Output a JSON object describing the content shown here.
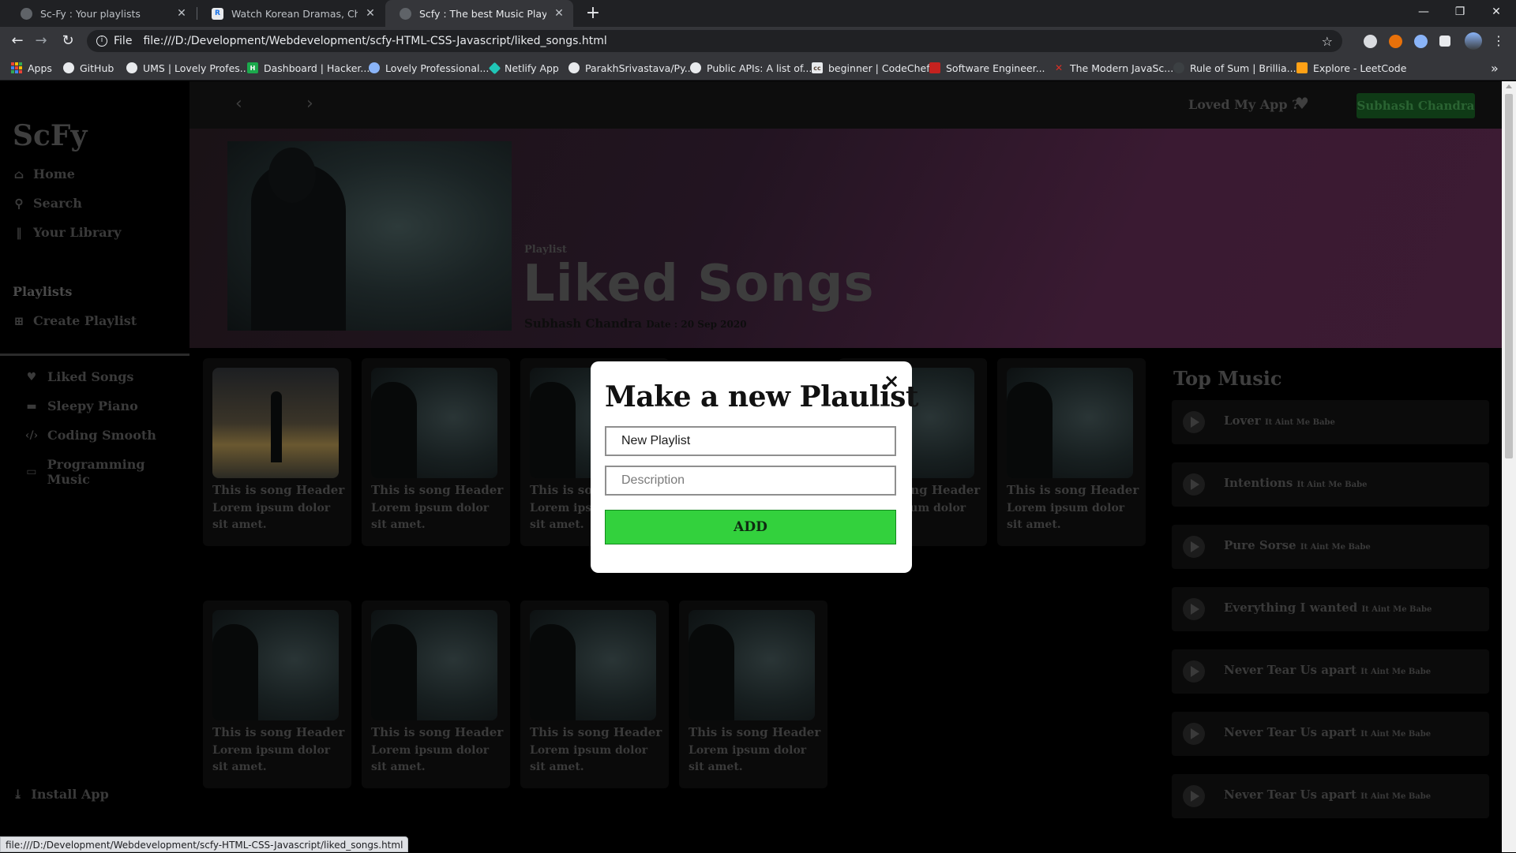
{
  "browser": {
    "tabs": [
      {
        "title": "Sc-Fy : Your playlists"
      },
      {
        "title": "Watch Korean Dramas, Chinese D"
      },
      {
        "title": "Scfy : The best Music Player"
      }
    ],
    "new_tab": "+",
    "window_controls": {
      "minimize": "—",
      "restore": "❐",
      "close": "✕"
    },
    "omnibox": {
      "protocol": "File",
      "url": "file:///D:/Development/Webdevelopment/scfy-HTML-CSS-Javascript/liked_songs.html"
    },
    "bookmarks": [
      "Apps",
      "GitHub",
      "UMS | Lovely Profes...",
      "Dashboard | Hacker...",
      "Lovely Professional...",
      "Netlify App",
      "ParakhSrivastava/Py...",
      "Public APIs: A list of...",
      "beginner | CodeChef",
      "Software Engineer...",
      "The Modern JavaSc...",
      "Rule of Sum | Brillia...",
      "Explore - LeetCode"
    ],
    "bookmarks_more": "»",
    "status_url": "file:///D:/Development/Webdevelopment/scfy-HTML-CSS-Javascript/liked_songs.html"
  },
  "sidebar": {
    "logo": "ScFy",
    "nav": [
      {
        "label": "Home",
        "icon": "home-icon"
      },
      {
        "label": "Search",
        "icon": "search-icon"
      },
      {
        "label": "Your Library",
        "icon": "library-icon"
      }
    ],
    "playlists_heading": "Playlists",
    "create_playlist": "Create Playlist",
    "playlists": [
      {
        "label": "Liked Songs",
        "icon": "heart-icon"
      },
      {
        "label": "Sleepy Piano",
        "icon": "bed-icon"
      },
      {
        "label": "Coding Smooth",
        "icon": "code-icon"
      },
      {
        "label": "Programming Music",
        "icon": "laptop-icon"
      }
    ],
    "install": "Install App"
  },
  "topnav": {
    "loved": "Loved My App ?",
    "user": "Subhash Chandra"
  },
  "banner": {
    "type": "Playlist",
    "title": "Liked Songs",
    "owner": "Subhash Chandra",
    "date": "Date : 20 Sep 2020"
  },
  "cards": [
    {
      "title": "This is song Header",
      "desc": "Lorem ipsum dolor sit amet."
    },
    {
      "title": "This is song Header",
      "desc": "Lorem ipsum dolor sit amet."
    },
    {
      "title": "This is song Header",
      "desc": "Lorem ipsum dolor sit amet."
    },
    {
      "title": "This is song Header",
      "desc": "Lorem ipsum dolor sit amet."
    },
    {
      "title": "This is song Header",
      "desc": "Lorem ipsum dolor sit amet."
    },
    {
      "title": "This is song Header",
      "desc": "Lorem ipsum dolor sit amet."
    },
    {
      "title": "This is song Header",
      "desc": "Lorem ipsum dolor sit amet."
    },
    {
      "title": "This is song Header",
      "desc": "Lorem ipsum dolor sit amet."
    },
    {
      "title": "This is song Header",
      "desc": "Lorem ipsum dolor sit amet."
    }
  ],
  "top_music": {
    "heading": "Top Music",
    "tracks": [
      {
        "name": "Lover",
        "artist": "It Aint Me Babe"
      },
      {
        "name": "Intentions",
        "artist": "It Aint Me Babe"
      },
      {
        "name": "Pure Sorse",
        "artist": "It Aint Me Babe"
      },
      {
        "name": "Everything I wanted",
        "artist": "It Aint Me Babe"
      },
      {
        "name": "Never Tear Us apart",
        "artist": "It Aint Me Babe"
      },
      {
        "name": "Never Tear Us apart",
        "artist": "It Aint Me Babe"
      },
      {
        "name": "Never Tear Us apart",
        "artist": "It Aint Me Babe"
      }
    ]
  },
  "modal": {
    "title": "Make a new Plaulist",
    "close": "×",
    "name_value": "New Playlist",
    "description_placeholder": "Description",
    "add_label": "ADD"
  }
}
